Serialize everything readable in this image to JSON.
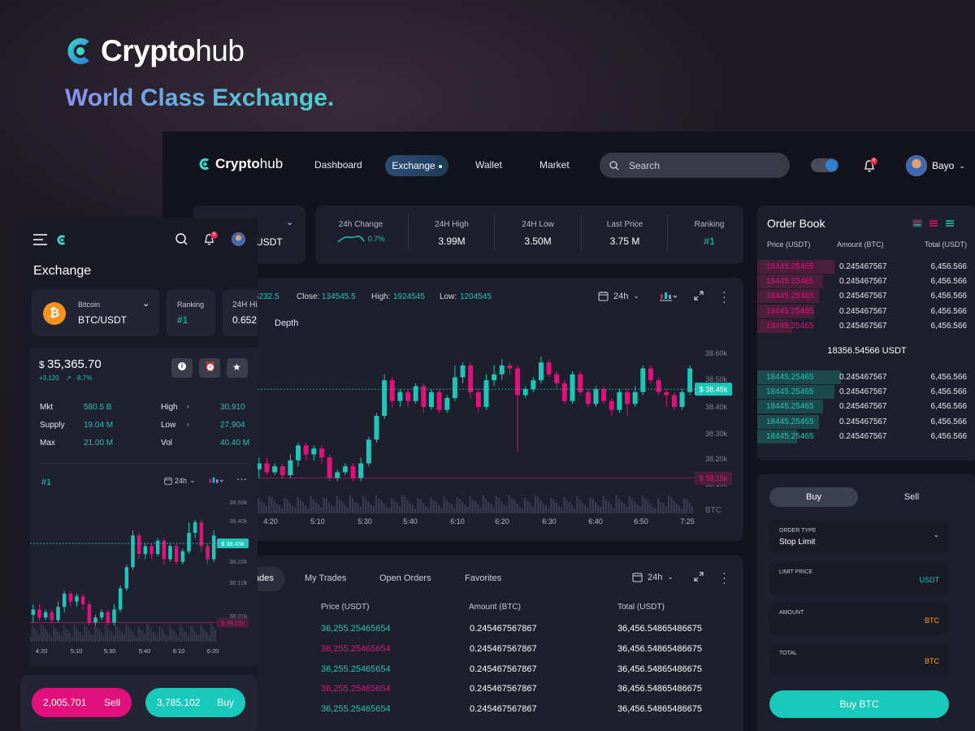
{
  "hero": {
    "brand_bold": "Crypto",
    "brand_light": "hub",
    "tagline": "World Class Exchange."
  },
  "nav": {
    "brand_bold": "Crypto",
    "brand_light": "hub",
    "items": [
      "Dashboard",
      "Exchange",
      "Wallet",
      "Market"
    ],
    "active": "Exchange",
    "search_placeholder": "Search",
    "notification_count": "6",
    "user_name": "Bayo"
  },
  "pair_selector": {
    "pair_fragment": "USDT"
  },
  "stats": [
    {
      "label": "24h Change",
      "value": "0.7%"
    },
    {
      "label": "24H High",
      "value": "3.99M"
    },
    {
      "label": "24H Low",
      "value": "3.50M"
    },
    {
      "label": "Last Price",
      "value": "3.75 M"
    },
    {
      "label": "Ranking",
      "value": "#1"
    }
  ],
  "chart_panel": {
    "open_fragment": "5232.5",
    "close_label": "Close:",
    "close_value": "134545.5",
    "high_label": "High:",
    "high_value": "1924545",
    "low_label": "Low:",
    "low_value": "1204545",
    "interval": "24h",
    "depth_tab": "Depth",
    "price_tag_high": "$ 38.45k",
    "price_tag_low": "$ 38.15k",
    "volume_axis_label": "BTC"
  },
  "chart_data": {
    "type": "candlestick",
    "x_ticks": [
      "4:20",
      "5:10",
      "5:30",
      "5:40",
      "6:10",
      "6:20",
      "6:30",
      "6:40",
      "6:50",
      "7:25"
    ],
    "y_ticks": [
      "38.60k",
      "38.50k",
      "38.40k",
      "38.30k",
      "38.20k",
      "38.10k"
    ],
    "ylim": [
      38.1,
      38.62
    ],
    "current_price": 38.45,
    "low_marker": 38.15,
    "candles": [
      [
        38.18,
        38.2,
        38.15,
        38.22
      ],
      [
        38.2,
        38.17,
        38.16,
        38.22
      ],
      [
        38.17,
        38.19,
        38.16,
        38.2
      ],
      [
        38.19,
        38.16,
        38.15,
        38.2
      ],
      [
        38.16,
        38.21,
        38.15,
        38.23
      ],
      [
        38.21,
        38.26,
        38.19,
        38.27
      ],
      [
        38.26,
        38.23,
        38.21,
        38.27
      ],
      [
        38.23,
        38.25,
        38.21,
        38.26
      ],
      [
        38.25,
        38.22,
        38.2,
        38.26
      ],
      [
        38.22,
        38.15,
        38.14,
        38.23
      ],
      [
        38.15,
        38.17,
        38.14,
        38.18
      ],
      [
        38.17,
        38.19,
        38.16,
        38.2
      ],
      [
        38.19,
        38.15,
        38.14,
        38.2
      ],
      [
        38.15,
        38.2,
        38.14,
        38.22
      ],
      [
        38.2,
        38.28,
        38.19,
        38.29
      ],
      [
        38.28,
        38.36,
        38.27,
        38.37
      ],
      [
        38.36,
        38.48,
        38.35,
        38.5
      ],
      [
        38.48,
        38.41,
        38.39,
        38.49
      ],
      [
        38.41,
        38.44,
        38.39,
        38.45
      ],
      [
        38.44,
        38.41,
        38.39,
        38.45
      ],
      [
        38.41,
        38.46,
        38.4,
        38.47
      ],
      [
        38.46,
        38.39,
        38.37,
        38.47
      ],
      [
        38.39,
        38.44,
        38.38,
        38.45
      ],
      [
        38.44,
        38.38,
        38.37,
        38.45
      ],
      [
        38.38,
        38.42,
        38.37,
        38.43
      ],
      [
        38.42,
        38.49,
        38.41,
        38.53
      ],
      [
        38.49,
        38.53,
        38.47,
        38.54
      ],
      [
        38.53,
        38.44,
        38.42,
        38.54
      ],
      [
        38.44,
        38.39,
        38.37,
        38.45
      ],
      [
        38.39,
        38.48,
        38.38,
        38.5
      ],
      [
        38.48,
        38.5,
        38.46,
        38.53
      ],
      [
        38.5,
        38.53,
        38.48,
        38.55
      ],
      [
        38.53,
        38.52,
        38.5,
        38.54
      ],
      [
        38.52,
        38.43,
        38.24,
        38.53
      ],
      [
        38.43,
        38.45,
        38.42,
        38.46
      ],
      [
        38.45,
        38.48,
        38.44,
        38.49
      ],
      [
        38.48,
        38.54,
        38.47,
        38.56
      ],
      [
        38.54,
        38.5,
        38.49,
        38.55
      ],
      [
        38.5,
        38.47,
        38.45,
        38.51
      ],
      [
        38.47,
        38.41,
        38.4,
        38.48
      ],
      [
        38.41,
        38.5,
        38.4,
        38.51
      ],
      [
        38.5,
        38.44,
        38.43,
        38.51
      ],
      [
        38.44,
        38.4,
        38.39,
        38.45
      ],
      [
        38.4,
        38.45,
        38.39,
        38.46
      ],
      [
        38.45,
        38.41,
        38.4,
        38.46
      ],
      [
        38.41,
        38.38,
        38.36,
        38.42
      ],
      [
        38.38,
        38.44,
        38.37,
        38.45
      ],
      [
        38.44,
        38.4,
        38.36,
        38.45
      ],
      [
        38.4,
        38.44,
        38.39,
        38.46
      ],
      [
        38.44,
        38.52,
        38.43,
        38.53
      ],
      [
        38.52,
        38.48,
        38.47,
        38.53
      ],
      [
        38.48,
        38.44,
        38.43,
        38.49
      ],
      [
        38.44,
        38.43,
        38.39,
        38.45
      ],
      [
        38.43,
        38.39,
        38.38,
        38.44
      ],
      [
        38.39,
        38.44,
        38.38,
        38.45
      ],
      [
        38.44,
        38.52,
        38.43,
        38.53
      ]
    ]
  },
  "orderbook": {
    "title": "Order Book",
    "headers": [
      "Price (USDT)",
      "Amount (BTC)",
      "Total (USDT)"
    ],
    "asks": [
      {
        "price": "18445.25465",
        "amount": "0.245467567",
        "total": "6,456.566",
        "depth": 0.35
      },
      {
        "price": "18445.25465",
        "amount": "0.245467567",
        "total": "6,456.566",
        "depth": 0.3
      },
      {
        "price": "18445.25465",
        "amount": "0.245467567",
        "total": "6,456.566",
        "depth": 0.28
      },
      {
        "price": "18445.25465",
        "amount": "0.245467567",
        "total": "6,456.566",
        "depth": 0.26
      },
      {
        "price": "18445.25465",
        "amount": "0.245467567",
        "total": "6,456.566",
        "depth": 0.16
      }
    ],
    "mid_price": "18356.54566 USDT",
    "bids": [
      {
        "price": "18445.25465",
        "amount": "0.245467567",
        "total": "6,456.566",
        "depth": 0.38
      },
      {
        "price": "18445.25465",
        "amount": "0.245467567",
        "total": "6,456.566",
        "depth": 0.35
      },
      {
        "price": "18445.25465",
        "amount": "0.245467567",
        "total": "6,456.566",
        "depth": 0.3
      },
      {
        "price": "18445.25465",
        "amount": "0.245467567",
        "total": "6,456.566",
        "depth": 0.28
      },
      {
        "price": "18445.25465",
        "amount": "0.245467567",
        "total": "6,456.566",
        "depth": 0.18
      }
    ]
  },
  "trade_form": {
    "buy_tab": "Buy",
    "sell_tab": "Sell",
    "order_type_label": "ORDER TYPE",
    "order_type_value": "Stop Limit",
    "limit_price_label": "LIMIT PRICE",
    "limit_price_unit": "USDT",
    "amount_label": "AMOUNT",
    "amount_unit": "BTC",
    "total_label": "TOTAL",
    "total_unit": "BTC",
    "submit": "Buy BTC"
  },
  "trades": {
    "tabs": [
      "ades",
      "My Trades",
      "Open Orders",
      "Favorites"
    ],
    "interval": "24h",
    "headers": [
      "Price (USDT)",
      "Amount (BTC)",
      "Total (USDT)"
    ],
    "rows": [
      {
        "price": "36,255.25465654",
        "amount": "0.245467567867",
        "total": "36,456.54865486675",
        "side": "buy"
      },
      {
        "price": "36,255.25465654",
        "amount": "0.245467567867",
        "total": "36,456.54865486675",
        "side": "sell"
      },
      {
        "price": "36,255.25465654",
        "amount": "0.245467567867",
        "total": "36,456.54865486675",
        "side": "buy"
      },
      {
        "price": "36,255.25465654",
        "amount": "0.245467567867",
        "total": "36,456.54865486675",
        "side": "sell"
      },
      {
        "price": "36,255.25465654",
        "amount": "0.245467567867",
        "total": "36,456.54865486675",
        "side": "buy"
      }
    ]
  },
  "mobile": {
    "notification_count": "6",
    "title": "Exchange",
    "coin_name": "Bitcoin",
    "pair": "BTC/USDT",
    "ranking_label": "Ranking",
    "ranking_value": "#1",
    "high_label": "24H Hi",
    "high_value": "0.652",
    "price_currency": "$",
    "price": "35,365.70",
    "change_abs": "+3,120",
    "change_pct": "8.7%",
    "stats_left": [
      {
        "k": "Mkt",
        "v": "580.5 B"
      },
      {
        "k": "Supply",
        "v": "19.04 M"
      },
      {
        "k": "Max",
        "v": "21.00 M"
      }
    ],
    "stats_right": [
      {
        "k": "High",
        "v": "30,910"
      },
      {
        "k": "Low",
        "v": "27,904"
      },
      {
        "k": "Vol",
        "v": "40.40 M"
      }
    ],
    "chart_rank": "#1",
    "interval": "24h",
    "price_tag_high": "$ 38.45k",
    "price_tag_low": "$ 38.15k",
    "y_ticks": [
      "38.50k",
      "38.40k",
      "38.30k",
      "38.20k",
      "38.10k",
      "38.01k"
    ],
    "x_ticks": [
      "4:20",
      "5:10",
      "5:30",
      "5:40",
      "6:10",
      "6:20"
    ],
    "sell_value": "2,005.701",
    "sell_label": "Sell",
    "buy_value": "3,785.102",
    "buy_label": "Buy"
  },
  "colors": {
    "teal": "#1fc6b8",
    "pink": "#e2107a",
    "panel": "#1e1f2d"
  }
}
